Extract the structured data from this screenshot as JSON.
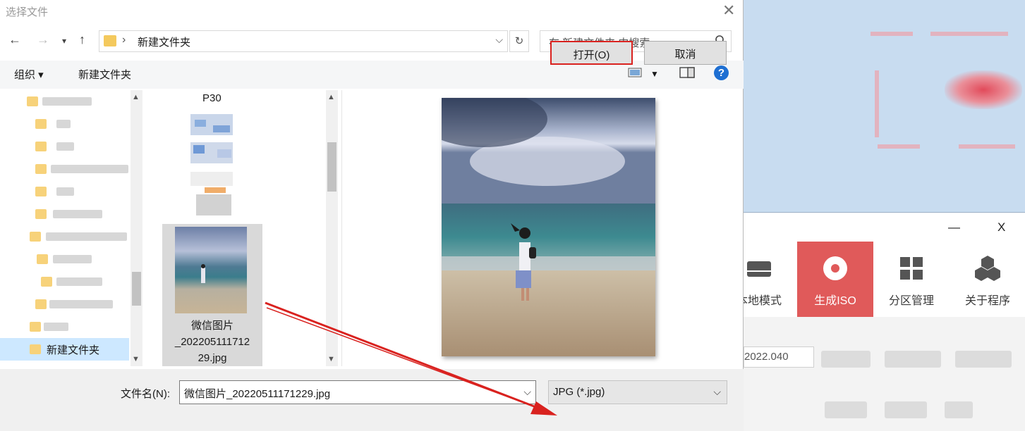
{
  "dialog": {
    "title": "选择文件",
    "address_path": "新建文件夹",
    "search_placeholder": "在 新建文件夹 中搜索",
    "toolbar": {
      "organize": "组织 ▾",
      "new_folder": "新建文件夹"
    },
    "tree": {
      "selected_folder": "新建文件夹"
    },
    "files": {
      "visible_folder_label": "P30",
      "selected_file_lines": [
        "微信图片",
        "_202205111712",
        "29.jpg"
      ]
    },
    "bottom": {
      "filename_label": "文件名(N):",
      "filename_value": "微信图片_20220511171229.jpg",
      "filter_value": "JPG (*.jpg)",
      "open_button": "打开(O)",
      "cancel_button": "取消"
    }
  },
  "background_app": {
    "window_controls": {
      "minimize": "—",
      "close": "X"
    },
    "nav_items": [
      {
        "label": "本地模式",
        "icon": "disk-icon",
        "active": false
      },
      {
        "label": "生成ISO",
        "icon": "disc-icon",
        "active": true
      },
      {
        "label": "分区管理",
        "icon": "grid-icon",
        "active": false
      },
      {
        "label": "关于程序",
        "icon": "hex-cluster-icon",
        "active": false
      }
    ],
    "field_value": "2022.040"
  },
  "colors": {
    "accent_red": "#e05a5a",
    "highlight_border": "#d9221f",
    "selection": "#cde8ff",
    "help_blue": "#1e6fd2"
  }
}
